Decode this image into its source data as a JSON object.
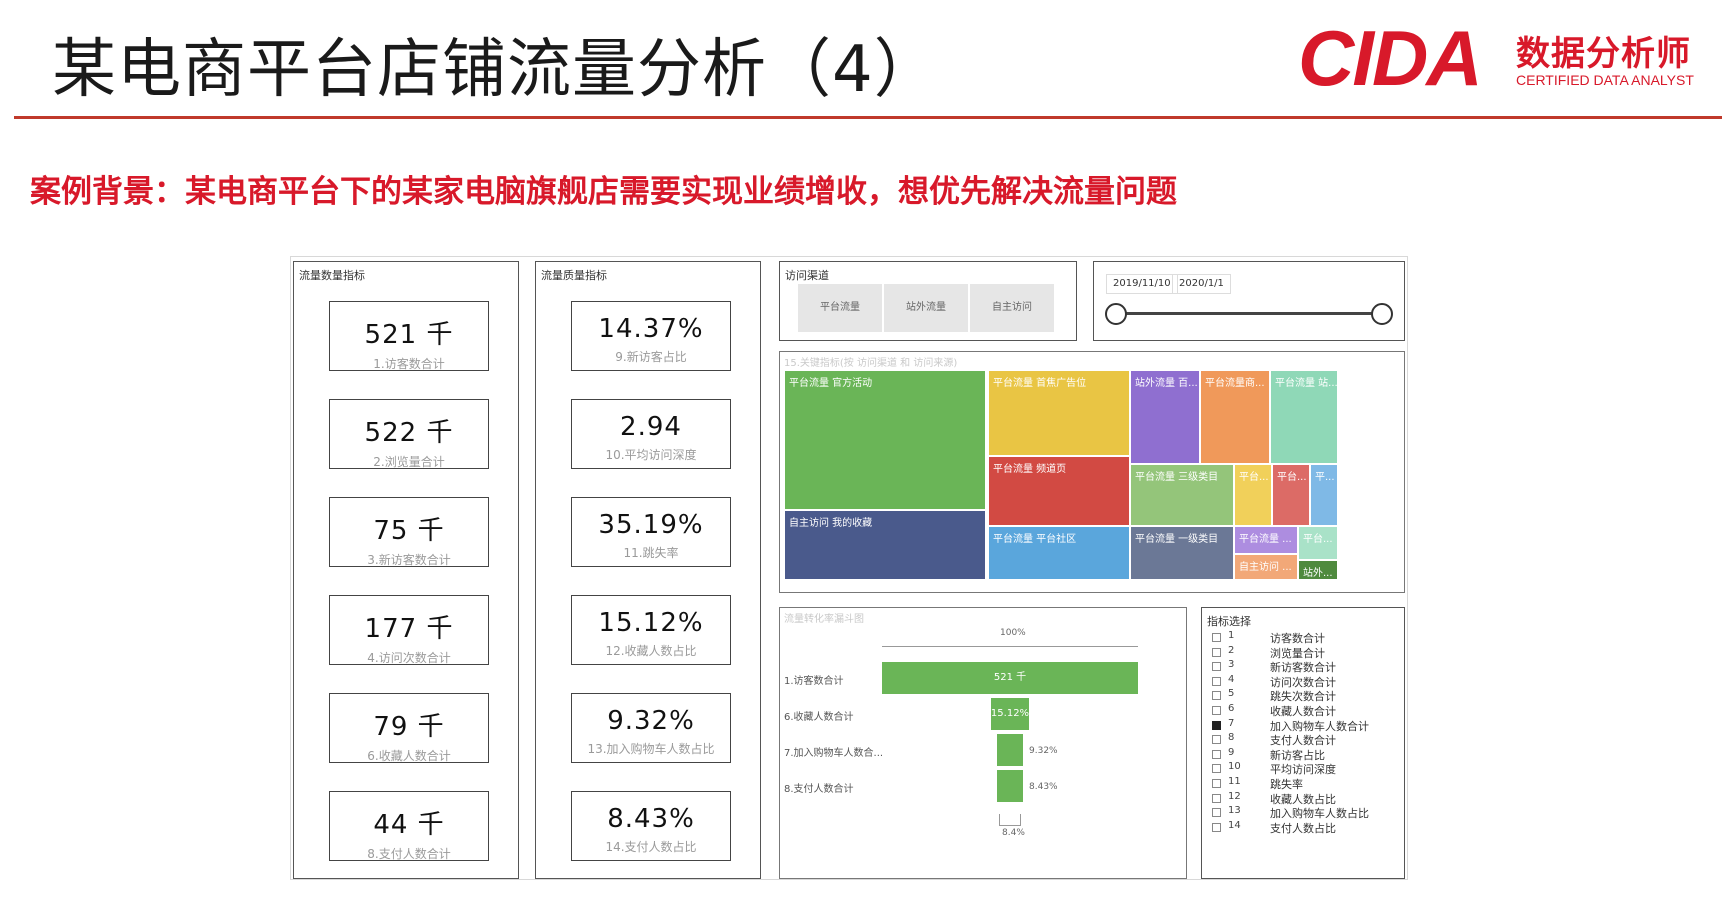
{
  "slide": {
    "title": "某电商平台店铺流量分析（4）",
    "background_text": "案例背景：某电商平台下的某家电脑旗舰店需要实现业绩增收，想优先解决流量问题",
    "accent_color": "#d8192a"
  },
  "logo": {
    "mark": "CIDA",
    "cn": "数据分析师",
    "en": "CERTIFIED DATA ANALYST"
  },
  "dashboard": {
    "quantity_panel": {
      "title": "流量数量指标",
      "kpis": [
        {
          "value": "521 千",
          "label": "1.访客数合计"
        },
        {
          "value": "522 千",
          "label": "2.浏览量合计"
        },
        {
          "value": "75 千",
          "label": "3.新访客数合计"
        },
        {
          "value": "177 千",
          "label": "4.访问次数合计"
        },
        {
          "value": "79 千",
          "label": "6.收藏人数合计"
        },
        {
          "value": "44 千",
          "label": "8.支付人数合计"
        }
      ]
    },
    "quality_panel": {
      "title": "流量质量指标",
      "kpis": [
        {
          "value": "14.37%",
          "label": "9.新访客占比"
        },
        {
          "value": "2.94",
          "label": "10.平均访问深度"
        },
        {
          "value": "35.19%",
          "label": "11.跳失率"
        },
        {
          "value": "15.12%",
          "label": "12.收藏人数占比"
        },
        {
          "value": "9.32%",
          "label": "13.加入购物车人数占比"
        },
        {
          "value": "8.43%",
          "label": "14.支付人数占比"
        }
      ]
    },
    "channel_slicer": {
      "title": "访问渠道",
      "buttons": [
        "平台流量",
        "站外流量",
        "自主访问"
      ]
    },
    "date_slicer": {
      "start": "2019/11/10",
      "end": "2020/1/1"
    },
    "treemap": {
      "title": "15.关键指标(按 访问渠道 和 访问来源)",
      "tiles": [
        {
          "label": "平台流量 官方活动",
          "color": "#6ab557"
        },
        {
          "label": "自主访问 我的收藏",
          "color": "#4a5a8c"
        },
        {
          "label": "平台流量 首焦广告位",
          "color": "#e9c544"
        },
        {
          "label": "平台流量 频道页",
          "color": "#d24a43"
        },
        {
          "label": "平台流量 平台社区",
          "color": "#5aa6dc"
        },
        {
          "label": "站外流量 百...",
          "color": "#8f6fd0"
        },
        {
          "label": "平台流量商...",
          "color": "#f0995a"
        },
        {
          "label": "平台流量 站...",
          "color": "#8fd8b7"
        },
        {
          "label": "平台流量 三级类目",
          "color": "#94c57a"
        },
        {
          "label": "平台流量 一级类目",
          "color": "#6b7896"
        },
        {
          "label": "平台...",
          "color": "#f1d05a"
        },
        {
          "label": "平台...",
          "color": "#dc6b66"
        },
        {
          "label": "平...",
          "color": "#7fb9e6"
        },
        {
          "label": "平台流量 ...",
          "color": "#ad8de0"
        },
        {
          "label": "自主访问 ...",
          "color": "#f2a878"
        },
        {
          "label": "平台...",
          "color": "#a9e2c8"
        },
        {
          "label": "站外...",
          "color": "#4f8a3e"
        }
      ]
    },
    "funnel": {
      "title": "流量转化率漏斗图",
      "top_pct": "100%",
      "stages": [
        {
          "label": "1.访客数合计",
          "bar_text": "521 千",
          "pct_of_top": 100
        },
        {
          "label": "6.收藏人数合计",
          "bar_text": "15.12%",
          "pct_of_top": 15.12
        },
        {
          "label": "7.加入购物车人数合...",
          "side_text": "9.32%",
          "pct_of_top": 9.32
        },
        {
          "label": "8.支付人数合计",
          "side_text": "8.43%",
          "pct_of_top": 8.43
        }
      ],
      "bottom_pct": "8.4%"
    },
    "metric_selector": {
      "title": "指标选择",
      "items": [
        {
          "num": "1",
          "label": "访客数合计",
          "checked": false
        },
        {
          "num": "2",
          "label": "浏览量合计",
          "checked": false
        },
        {
          "num": "3",
          "label": "新访客数合计",
          "checked": false
        },
        {
          "num": "4",
          "label": "访问次数合计",
          "checked": false
        },
        {
          "num": "5",
          "label": "跳失次数合计",
          "checked": false
        },
        {
          "num": "6",
          "label": "收藏人数合计",
          "checked": false
        },
        {
          "num": "7",
          "label": "加入购物车人数合计",
          "checked": true
        },
        {
          "num": "8",
          "label": "支付人数合计",
          "checked": false
        },
        {
          "num": "9",
          "label": "新访客占比",
          "checked": false
        },
        {
          "num": "10",
          "label": "平均访问深度",
          "checked": false
        },
        {
          "num": "11",
          "label": "跳失率",
          "checked": false
        },
        {
          "num": "12",
          "label": "收藏人数占比",
          "checked": false
        },
        {
          "num": "13",
          "label": "加入购物车人数占比",
          "checked": false
        },
        {
          "num": "14",
          "label": "支付人数占比",
          "checked": false
        }
      ]
    }
  }
}
